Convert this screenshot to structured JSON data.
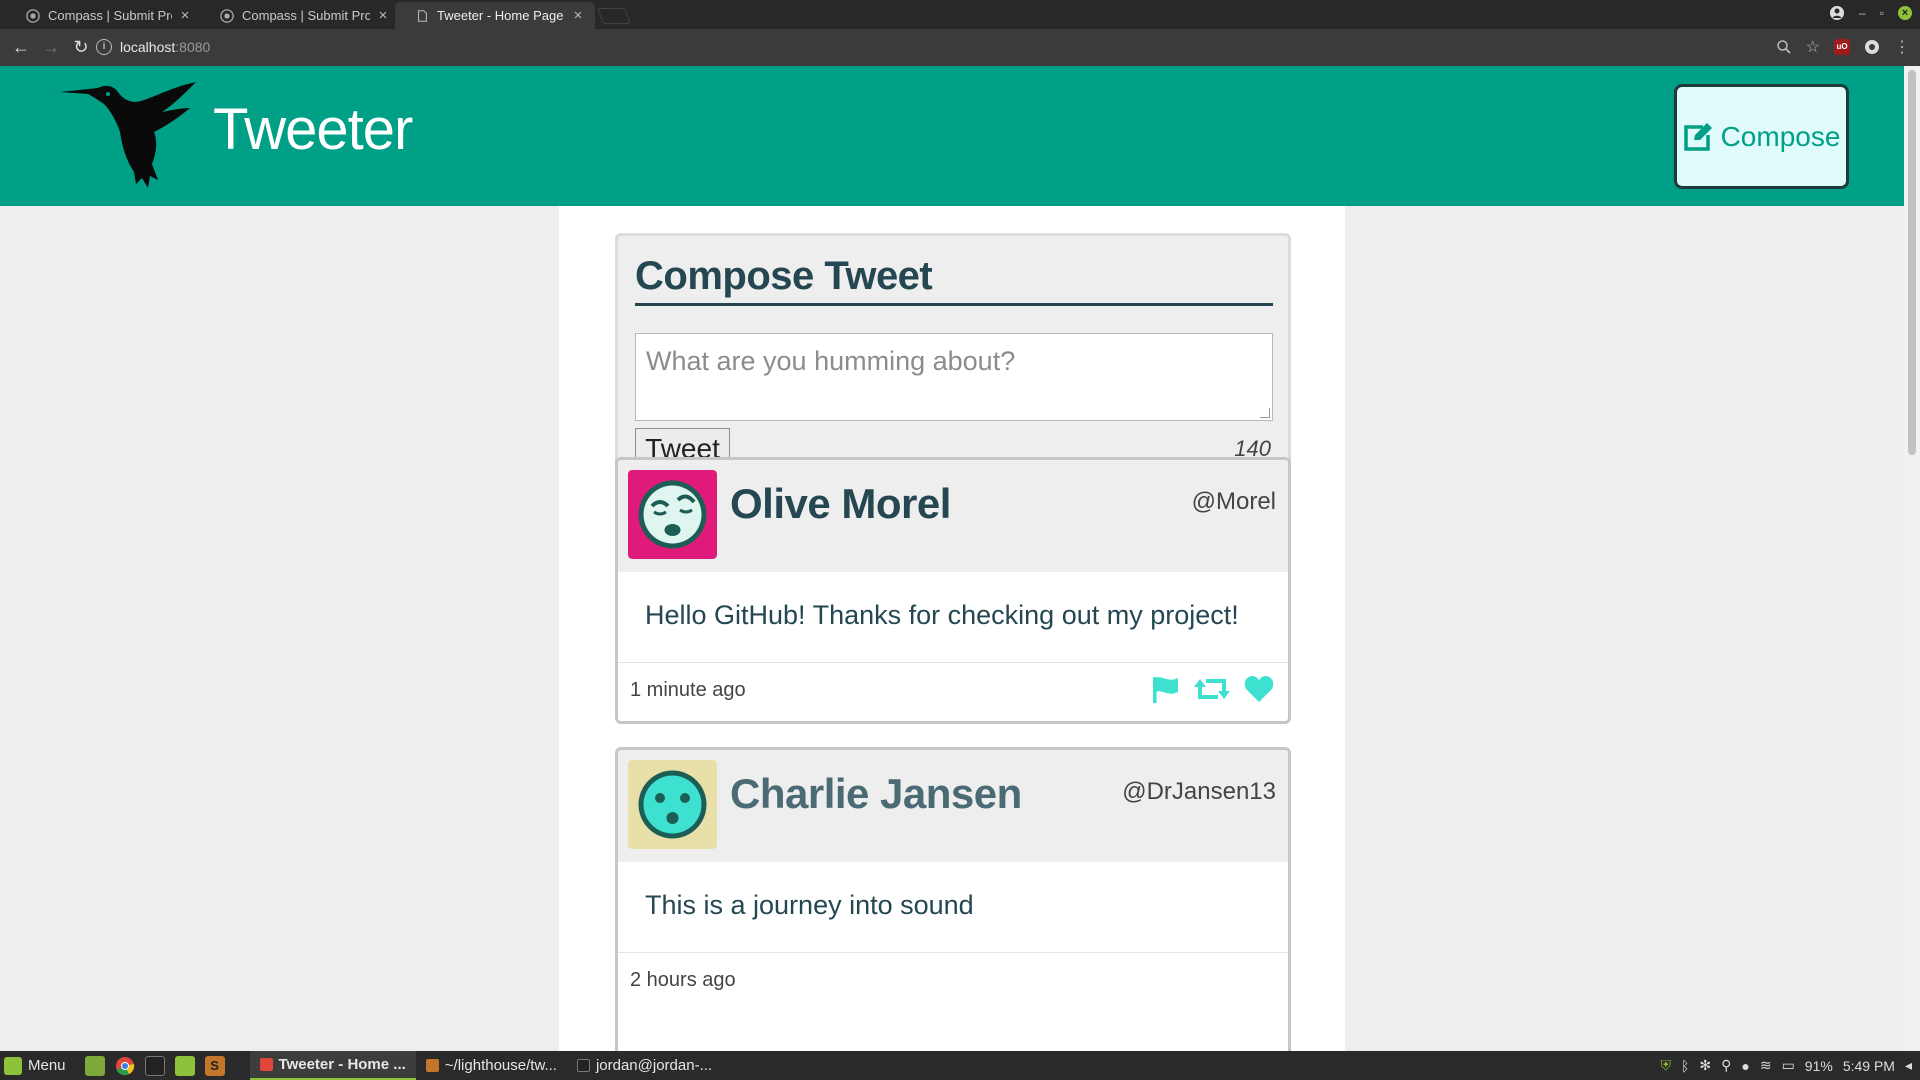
{
  "browser": {
    "tabs": [
      {
        "title": "Compass | Submit Proje",
        "active": false,
        "icon": "github-icon"
      },
      {
        "title": "Compass | Submit Proje",
        "active": false,
        "icon": "github-icon"
      },
      {
        "title": "Tweeter - Home Page",
        "active": true,
        "icon": "page-icon"
      }
    ],
    "url_host": "localhost",
    "url_port": ":8080"
  },
  "site": {
    "title": "Tweeter",
    "compose_label": "Compose",
    "colors": {
      "header": "#00a087",
      "accent": "#3ee0d0",
      "dark": "#244751"
    }
  },
  "compose": {
    "heading": "Compose Tweet",
    "placeholder": "What are you humming about?",
    "submit_label": "Tweet",
    "counter": "140"
  },
  "tweets": [
    {
      "name": "Olive Morel",
      "handle": "@Morel",
      "text": "Hello GitHub! Thanks for checking out my project!",
      "time": "1 minute ago",
      "avatar_bg": "#e01a7a"
    },
    {
      "name": "Charlie Jansen",
      "handle": "@DrJansen13",
      "text": "This is a journey into sound",
      "time": "2 hours ago",
      "avatar_bg": "#e8e0a8"
    }
  ],
  "taskbar": {
    "menu_label": "Menu",
    "windows": [
      {
        "title": "Tweeter - Home ...",
        "active": true
      },
      {
        "title": "~/lighthouse/tw...",
        "active": false
      },
      {
        "title": "jordan@jordan-...",
        "active": false
      }
    ],
    "battery": "91%",
    "clock": "5:49 PM"
  }
}
